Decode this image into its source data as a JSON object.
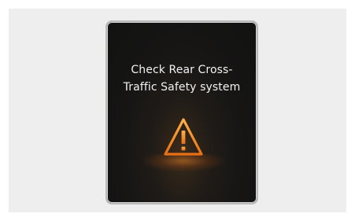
{
  "alert": {
    "line1": "Check Rear Cross-",
    "line2": "Traffic Safety system",
    "icon": "warning-triangle-icon",
    "accent_color": "#f08a2a",
    "text_color": "#f2f2f2",
    "background_color": "#161514"
  }
}
